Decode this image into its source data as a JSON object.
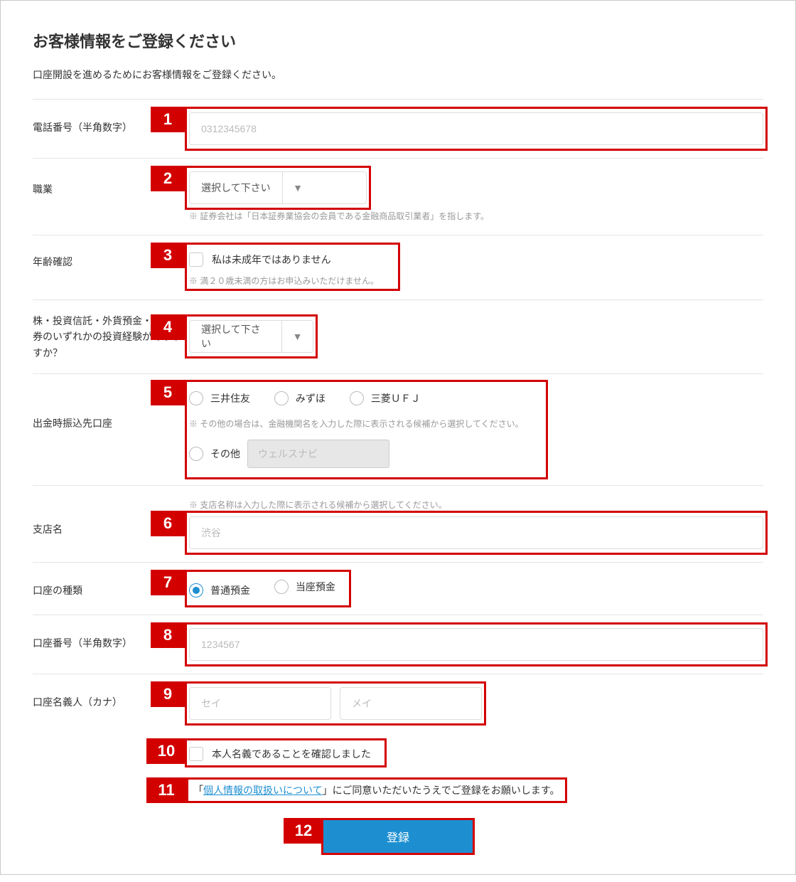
{
  "heading": "お客様情報をご登録ください",
  "lead": "口座開設を進めるためにお客様情報をご登録ください。",
  "phone": {
    "label": "電話番号（半角数字）",
    "placeholder": "0312345678"
  },
  "job": {
    "label": "職業",
    "select": "選択して下さい",
    "hint": "※ 証券会社は「日本証券業協会の会員である金融商品取引業者」を指します。"
  },
  "age": {
    "label": "年齢確認",
    "check": "私は未成年ではありません",
    "hint": "※ 満２０歳未満の方はお申込みいただけません。"
  },
  "exp": {
    "label": "株・投資信託・外貨預金・FX・債券のいずれかの投資経験がありますか？",
    "select": "選択して下さい"
  },
  "bank": {
    "label": "出金時振込先口座",
    "opt1": "三井住友",
    "opt2": "みずほ",
    "opt3": "三菱ＵＦＪ",
    "opt4": "その他",
    "hint": "※ その他の場合は、金融機関名を入力した際に表示される候補から選択してください。",
    "other_ph": "ウェルスナビ"
  },
  "branch": {
    "label": "支店名",
    "hint": "※ 支店名称は入力した際に表示される候補から選択してください。",
    "placeholder": "渋谷"
  },
  "accType": {
    "label": "口座の種類",
    "opt1": "普通預金",
    "opt2": "当座預金"
  },
  "accNo": {
    "label": "口座番号（半角数字）",
    "placeholder": "1234567"
  },
  "holder": {
    "label": "口座名義人（カナ）",
    "ph1": "セイ",
    "ph2": "メイ"
  },
  "selfConfirm": "本人名義であることを確認しました",
  "privacy_pre": "「",
  "privacy_link": "個人情報の取扱いについて",
  "privacy_post": "」にご同意いただいたうえでご登録をお願いします。",
  "submit": "登録"
}
